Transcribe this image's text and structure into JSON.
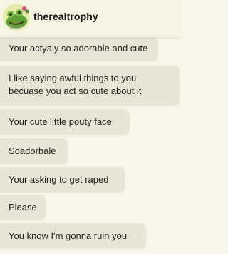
{
  "header": {
    "username": "therealtrophy",
    "avatar_icon": "green-frog-avatar-icon"
  },
  "messages": [
    {
      "text": "Your actyaly so adorable and cute"
    },
    {
      "text": "I like saying awful things to you becuase you act so cute about it"
    },
    {
      "text": "Your cute little pouty face"
    },
    {
      "text": "Soadorbale"
    },
    {
      "text": "Your asking to get raped"
    },
    {
      "text": "Please"
    },
    {
      "text": "You know I'm gonna ruin you"
    }
  ],
  "colors": {
    "background": "#f7f4e8",
    "bubble": "#e9e5d4",
    "text": "#1c1c1c"
  }
}
